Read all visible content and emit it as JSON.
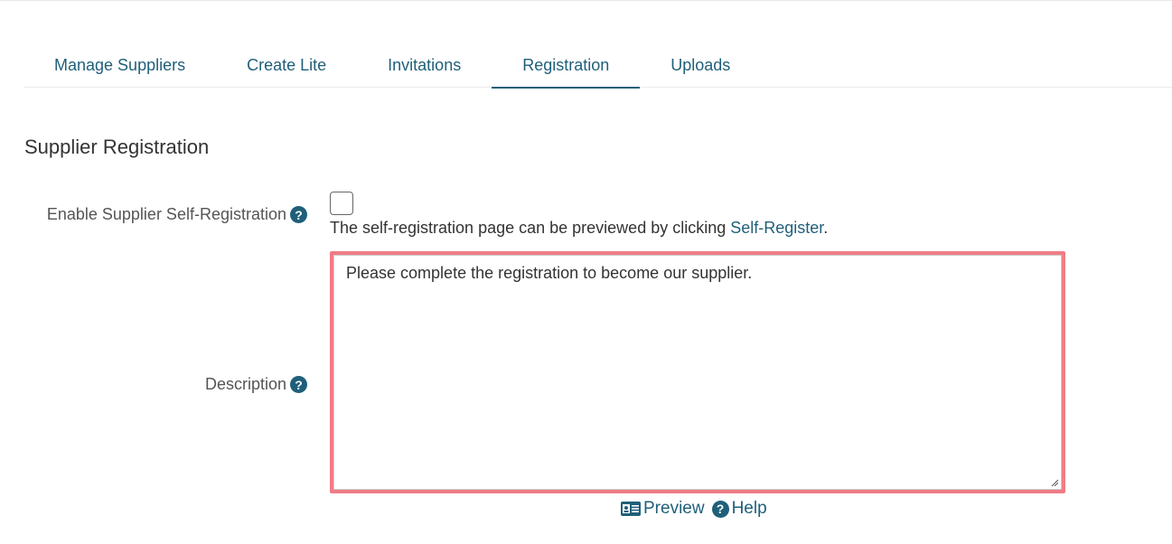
{
  "tabs": [
    {
      "label": "Manage Suppliers"
    },
    {
      "label": "Create Lite"
    },
    {
      "label": "Invitations"
    },
    {
      "label": "Registration",
      "active": true
    },
    {
      "label": "Uploads"
    }
  ],
  "section": {
    "title": "Supplier Registration"
  },
  "self_registration": {
    "label": "Enable Supplier Self-Registration",
    "checked": false,
    "hint_prefix": "The self-registration page can be previewed by clicking ",
    "hint_link": "Self-Register",
    "hint_suffix": "."
  },
  "description": {
    "label": "Description",
    "value": "Please complete the registration to become our supplier."
  },
  "actions": {
    "preview_label": "Preview",
    "help_label": "Help"
  },
  "icons": {
    "help": "question-circle-icon",
    "preview": "id-card-icon"
  },
  "colors": {
    "accent": "#1f5f7a",
    "highlight_border": "#f07c85"
  }
}
